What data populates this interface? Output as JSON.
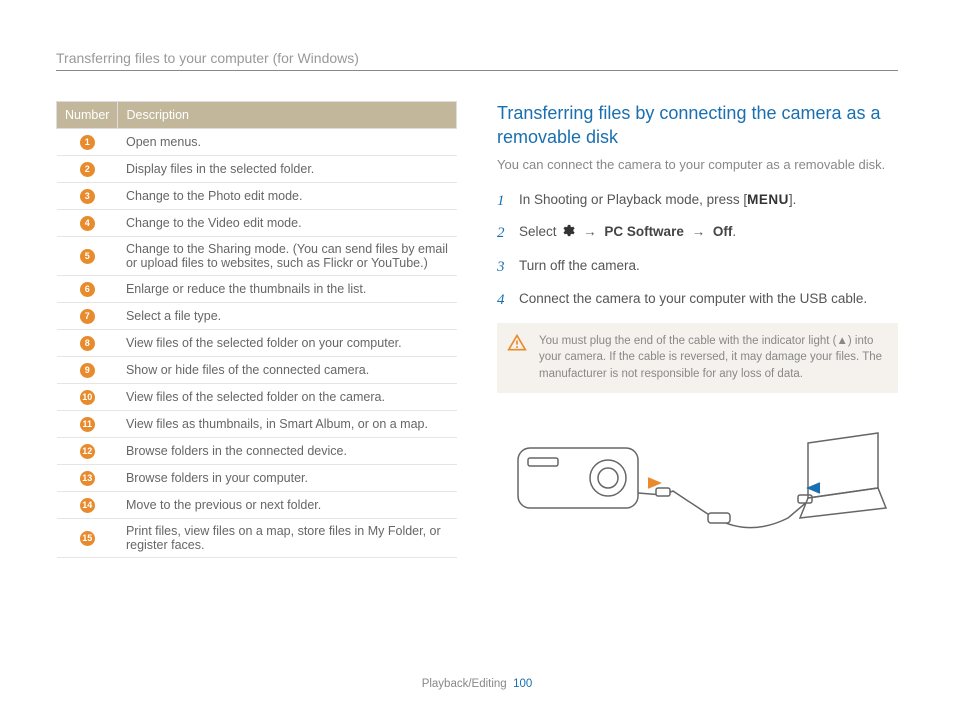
{
  "header": {
    "title": "Transferring files to your computer (for Windows)"
  },
  "table": {
    "col_number": "Number",
    "col_description": "Description",
    "rows": [
      {
        "n": "1",
        "desc": "Open menus."
      },
      {
        "n": "2",
        "desc": "Display files in the selected folder."
      },
      {
        "n": "3",
        "desc": "Change to the Photo edit mode."
      },
      {
        "n": "4",
        "desc": "Change to the Video edit mode."
      },
      {
        "n": "5",
        "desc": "Change to the Sharing mode. (You can send files by email or upload files to websites, such as Flickr or YouTube.)"
      },
      {
        "n": "6",
        "desc": "Enlarge or reduce the thumbnails in the list."
      },
      {
        "n": "7",
        "desc": "Select a file type."
      },
      {
        "n": "8",
        "desc": "View files of the selected folder on your computer."
      },
      {
        "n": "9",
        "desc": "Show or hide files of the connected camera."
      },
      {
        "n": "10",
        "desc": "View files of the selected folder on the camera."
      },
      {
        "n": "11",
        "desc": "View files as thumbnails, in Smart Album, or on a map."
      },
      {
        "n": "12",
        "desc": "Browse folders in the connected device."
      },
      {
        "n": "13",
        "desc": "Browse folders in your computer."
      },
      {
        "n": "14",
        "desc": "Move to the previous or next folder."
      },
      {
        "n": "15",
        "desc": "Print files, view files on a map, store files in My Folder, or register faces."
      }
    ]
  },
  "section": {
    "title": "Transferring files by connecting the camera as a removable disk",
    "lead": "You can connect the camera to your computer as a removable disk.",
    "step1_pre": "In Shooting or Playback mode, press [",
    "step1_menu": "MENU",
    "step1_post": "].",
    "step2_select": "Select ",
    "step2_arrow": "→",
    "step2_pc": "PC Software",
    "step2_off": "Off",
    "step2_dot": ".",
    "step3": "Turn off the camera.",
    "step4": "Connect the camera to your computer with the USB cable."
  },
  "callout": {
    "text": "You must plug the end of the cable with the indicator light (▲) into your camera. If the cable is reversed, it may damage your files. The manufacturer is not responsible for any loss of data."
  },
  "footer": {
    "section": "Playback/Editing",
    "page": "100"
  }
}
